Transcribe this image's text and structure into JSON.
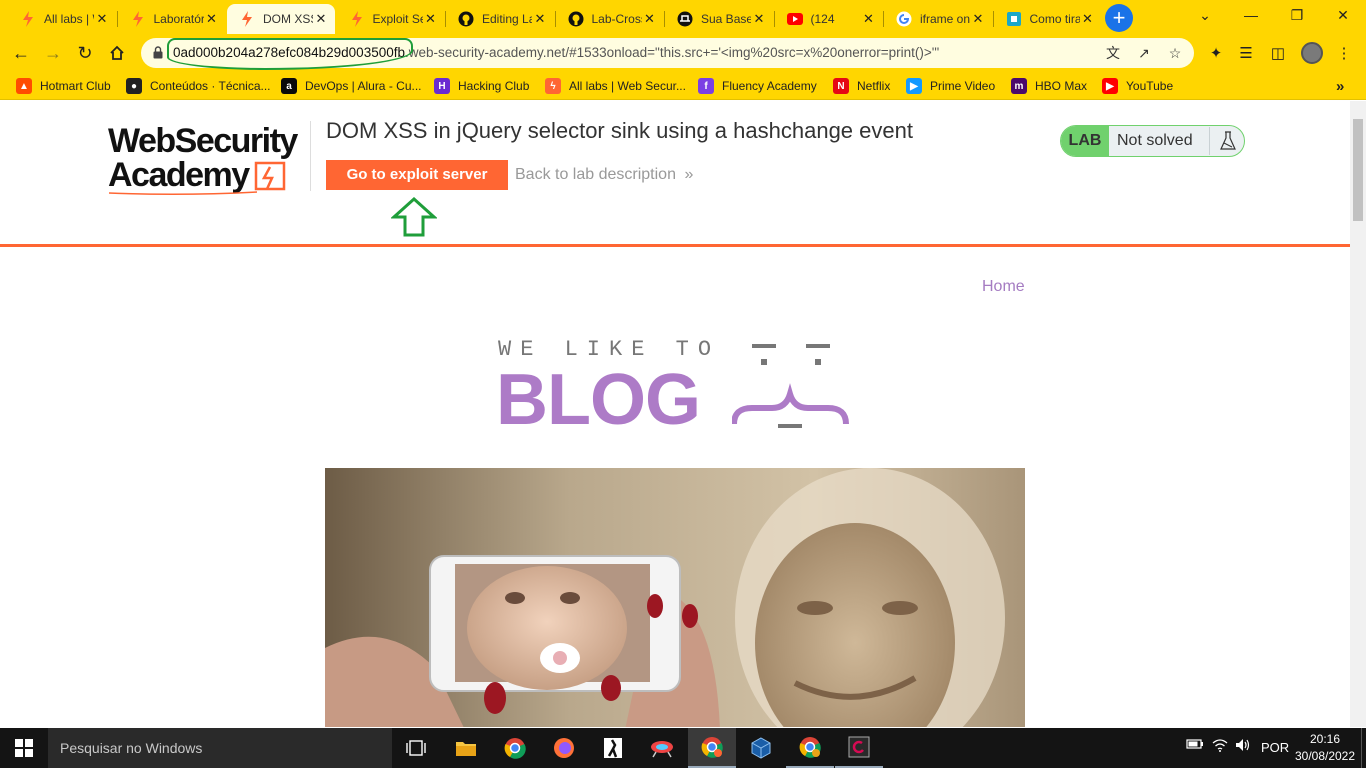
{
  "browser": {
    "tabs": [
      {
        "title": "All labs | Web Security Academy",
        "favicon": "burp-icon",
        "active": false
      },
      {
        "title": "Laboratório",
        "favicon": "burp-icon",
        "active": false
      },
      {
        "title": "DOM XSS in jQuery selector sink",
        "favicon": "burp-icon",
        "active": true
      },
      {
        "title": "Exploit Server",
        "favicon": "burp-icon",
        "active": false
      },
      {
        "title": "Editing Lab",
        "favicon": "github-icon",
        "active": false
      },
      {
        "title": "Lab-Cross",
        "favicon": "github-icon",
        "active": false
      },
      {
        "title": "Sua Base",
        "favicon": "hat-icon",
        "active": false
      },
      {
        "title": "(124",
        "favicon": "youtube-icon",
        "active": false
      },
      {
        "title": "iframe on",
        "favicon": "google-icon",
        "active": false
      },
      {
        "title": "Como tirar",
        "favicon": "page-icon",
        "active": false
      }
    ],
    "url": {
      "host_highlight": "0ad000b204a278efc084b29d003500fb",
      "rest": ".web-security-academy.net/#1533onload=\"this.src+='<img%20src=x%20onerror=print()>'\""
    },
    "bookmarks": [
      {
        "label": "Hotmart Club",
        "color": "#ff4d00"
      },
      {
        "label": "Conteúdos · Técnica...",
        "color": "#222222"
      },
      {
        "label": "DevOps | Alura - Cu...",
        "color": "#0a0a0a"
      },
      {
        "label": "Hacking Club",
        "color": "#6a2bd1"
      },
      {
        "label": "All labs | Web Secur...",
        "color": "#ff6633"
      },
      {
        "label": "Fluency Academy",
        "color": "#7b3fe4"
      },
      {
        "label": "Netflix",
        "color": "#e50914"
      },
      {
        "label": "Prime Video",
        "color": "#1399ff"
      },
      {
        "label": "HBO Max",
        "color": "#4b0a6b"
      },
      {
        "label": "YouTube",
        "color": "#ff0000"
      }
    ],
    "bookmarks_more": "»"
  },
  "page": {
    "logo_line1": "WebSecurity",
    "logo_line2": "Academy",
    "lab_title": "DOM XSS in jQuery selector sink using a hashchange event",
    "exploit_button": "Go to exploit server",
    "back_link": "Back to lab description",
    "back_chevron": "»",
    "lab_tag": "LAB",
    "lab_status": "Not solved",
    "nav_home": "Home",
    "banner_top": "WE LIKE TO",
    "banner_main": "BLOG",
    "accent_color": "#ff6633",
    "status_color": "#70d16d",
    "annotation_color": "#1f9e3a"
  },
  "taskbar": {
    "search_placeholder": "Pesquisar no Windows",
    "language": "POR",
    "time": "20:16",
    "date": "30/08/2022"
  }
}
